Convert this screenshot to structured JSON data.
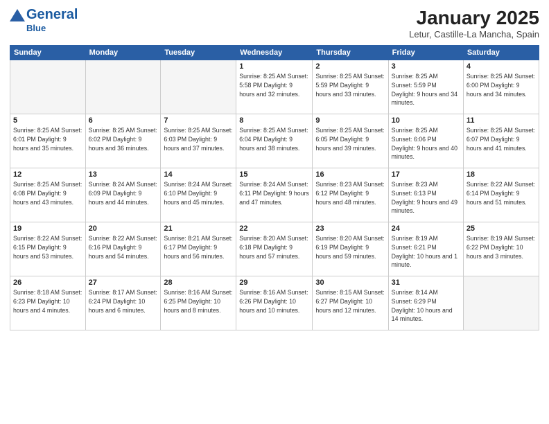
{
  "header": {
    "logo_text_general": "General",
    "logo_text_blue": "Blue",
    "month_title": "January 2025",
    "location": "Letur, Castille-La Mancha, Spain"
  },
  "weekdays": [
    "Sunday",
    "Monday",
    "Tuesday",
    "Wednesday",
    "Thursday",
    "Friday",
    "Saturday"
  ],
  "weeks": [
    [
      {
        "day": "",
        "info": ""
      },
      {
        "day": "",
        "info": ""
      },
      {
        "day": "",
        "info": ""
      },
      {
        "day": "1",
        "info": "Sunrise: 8:25 AM\nSunset: 5:58 PM\nDaylight: 9 hours and 32 minutes."
      },
      {
        "day": "2",
        "info": "Sunrise: 8:25 AM\nSunset: 5:59 PM\nDaylight: 9 hours and 33 minutes."
      },
      {
        "day": "3",
        "info": "Sunrise: 8:25 AM\nSunset: 5:59 PM\nDaylight: 9 hours and 34 minutes."
      },
      {
        "day": "4",
        "info": "Sunrise: 8:25 AM\nSunset: 6:00 PM\nDaylight: 9 hours and 34 minutes."
      }
    ],
    [
      {
        "day": "5",
        "info": "Sunrise: 8:25 AM\nSunset: 6:01 PM\nDaylight: 9 hours and 35 minutes."
      },
      {
        "day": "6",
        "info": "Sunrise: 8:25 AM\nSunset: 6:02 PM\nDaylight: 9 hours and 36 minutes."
      },
      {
        "day": "7",
        "info": "Sunrise: 8:25 AM\nSunset: 6:03 PM\nDaylight: 9 hours and 37 minutes."
      },
      {
        "day": "8",
        "info": "Sunrise: 8:25 AM\nSunset: 6:04 PM\nDaylight: 9 hours and 38 minutes."
      },
      {
        "day": "9",
        "info": "Sunrise: 8:25 AM\nSunset: 6:05 PM\nDaylight: 9 hours and 39 minutes."
      },
      {
        "day": "10",
        "info": "Sunrise: 8:25 AM\nSunset: 6:06 PM\nDaylight: 9 hours and 40 minutes."
      },
      {
        "day": "11",
        "info": "Sunrise: 8:25 AM\nSunset: 6:07 PM\nDaylight: 9 hours and 41 minutes."
      }
    ],
    [
      {
        "day": "12",
        "info": "Sunrise: 8:25 AM\nSunset: 6:08 PM\nDaylight: 9 hours and 43 minutes."
      },
      {
        "day": "13",
        "info": "Sunrise: 8:24 AM\nSunset: 6:09 PM\nDaylight: 9 hours and 44 minutes."
      },
      {
        "day": "14",
        "info": "Sunrise: 8:24 AM\nSunset: 6:10 PM\nDaylight: 9 hours and 45 minutes."
      },
      {
        "day": "15",
        "info": "Sunrise: 8:24 AM\nSunset: 6:11 PM\nDaylight: 9 hours and 47 minutes."
      },
      {
        "day": "16",
        "info": "Sunrise: 8:23 AM\nSunset: 6:12 PM\nDaylight: 9 hours and 48 minutes."
      },
      {
        "day": "17",
        "info": "Sunrise: 8:23 AM\nSunset: 6:13 PM\nDaylight: 9 hours and 49 minutes."
      },
      {
        "day": "18",
        "info": "Sunrise: 8:22 AM\nSunset: 6:14 PM\nDaylight: 9 hours and 51 minutes."
      }
    ],
    [
      {
        "day": "19",
        "info": "Sunrise: 8:22 AM\nSunset: 6:15 PM\nDaylight: 9 hours and 53 minutes."
      },
      {
        "day": "20",
        "info": "Sunrise: 8:22 AM\nSunset: 6:16 PM\nDaylight: 9 hours and 54 minutes."
      },
      {
        "day": "21",
        "info": "Sunrise: 8:21 AM\nSunset: 6:17 PM\nDaylight: 9 hours and 56 minutes."
      },
      {
        "day": "22",
        "info": "Sunrise: 8:20 AM\nSunset: 6:18 PM\nDaylight: 9 hours and 57 minutes."
      },
      {
        "day": "23",
        "info": "Sunrise: 8:20 AM\nSunset: 6:19 PM\nDaylight: 9 hours and 59 minutes."
      },
      {
        "day": "24",
        "info": "Sunrise: 8:19 AM\nSunset: 6:21 PM\nDaylight: 10 hours and 1 minute."
      },
      {
        "day": "25",
        "info": "Sunrise: 8:19 AM\nSunset: 6:22 PM\nDaylight: 10 hours and 3 minutes."
      }
    ],
    [
      {
        "day": "26",
        "info": "Sunrise: 8:18 AM\nSunset: 6:23 PM\nDaylight: 10 hours and 4 minutes."
      },
      {
        "day": "27",
        "info": "Sunrise: 8:17 AM\nSunset: 6:24 PM\nDaylight: 10 hours and 6 minutes."
      },
      {
        "day": "28",
        "info": "Sunrise: 8:16 AM\nSunset: 6:25 PM\nDaylight: 10 hours and 8 minutes."
      },
      {
        "day": "29",
        "info": "Sunrise: 8:16 AM\nSunset: 6:26 PM\nDaylight: 10 hours and 10 minutes."
      },
      {
        "day": "30",
        "info": "Sunrise: 8:15 AM\nSunset: 6:27 PM\nDaylight: 10 hours and 12 minutes."
      },
      {
        "day": "31",
        "info": "Sunrise: 8:14 AM\nSunset: 6:29 PM\nDaylight: 10 hours and 14 minutes."
      },
      {
        "day": "",
        "info": ""
      }
    ]
  ]
}
